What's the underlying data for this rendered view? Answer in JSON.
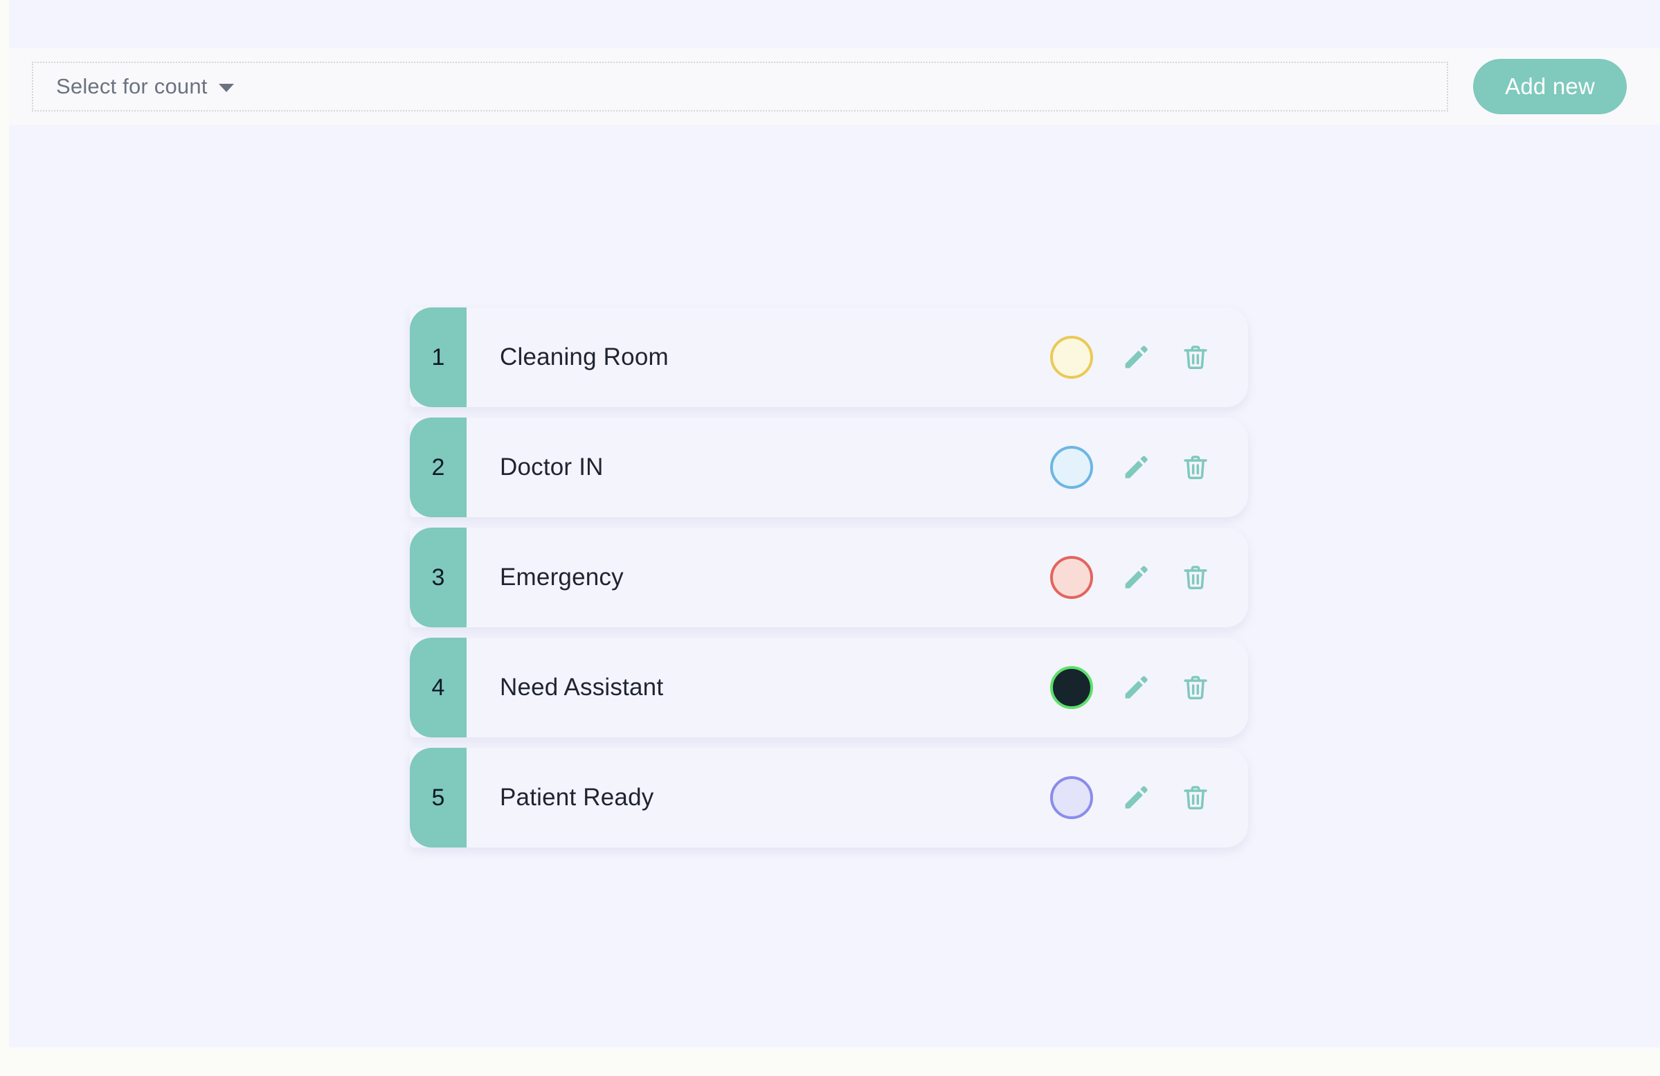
{
  "theme": {
    "accent_teal": "#7fc9bd",
    "page_bg": "#fbfbf8",
    "canvas_bg": "#f4f4fe",
    "header_bg": "#f9f9fb",
    "card_bg": "#f4f4fd",
    "text_dark": "#1f2430",
    "text_muted": "#6b7280"
  },
  "header": {
    "select_count_label": "Select for count",
    "caret_icon": "chevron-down-icon",
    "add_new_label": "Add new"
  },
  "list": {
    "rows": [
      {
        "number": "1",
        "name": "Cleaning Room",
        "color_fill": "#fcf8e0",
        "color_border": "#e9ca56",
        "edit_icon": "pencil-icon",
        "delete_icon": "trash-icon"
      },
      {
        "number": "2",
        "name": "Doctor IN",
        "color_fill": "#e4f3fb",
        "color_border": "#6cb6e4",
        "edit_icon": "pencil-icon",
        "delete_icon": "trash-icon"
      },
      {
        "number": "3",
        "name": "Emergency",
        "color_fill": "#fadcd7",
        "color_border": "#e2655e",
        "edit_icon": "pencil-icon",
        "delete_icon": "trash-icon"
      },
      {
        "number": "4",
        "name": "Need Assistant",
        "color_fill": "#16242c",
        "color_border": "#5ce06a",
        "edit_icon": "pencil-icon",
        "delete_icon": "trash-icon"
      },
      {
        "number": "5",
        "name": "Patient Ready",
        "color_fill": "#e3e3fa",
        "color_border": "#8a8ceb",
        "edit_icon": "pencil-icon",
        "delete_icon": "trash-icon"
      }
    ]
  }
}
